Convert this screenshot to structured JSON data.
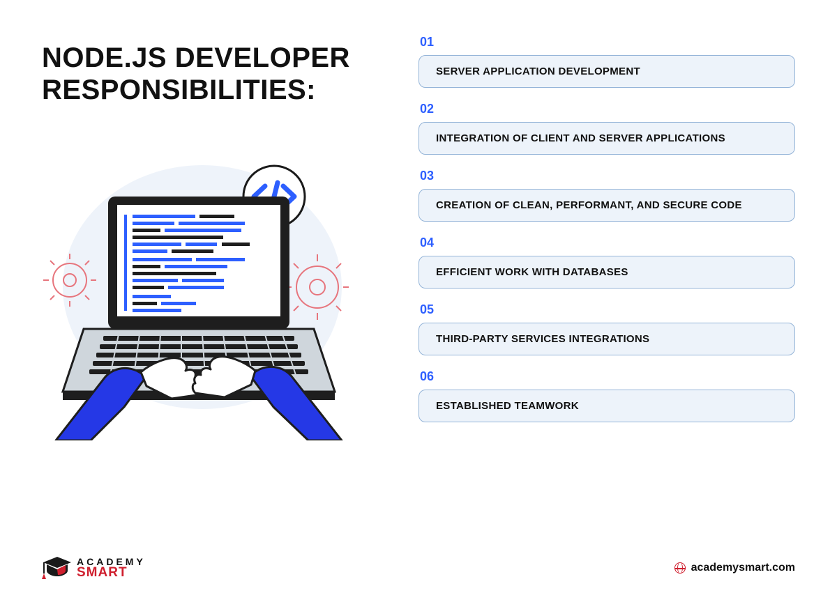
{
  "title": "NODE.JS DEVELOPER\nRESPONSIBILITIES:",
  "items": [
    {
      "num": "01",
      "text": "SERVER APPLICATION DEVELOPMENT"
    },
    {
      "num": "02",
      "text": "INTEGRATION OF CLIENT AND SERVER APPLICATIONS"
    },
    {
      "num": "03",
      "text": "CREATION OF CLEAN, PERFORMANT, AND SECURE CODE"
    },
    {
      "num": "04",
      "text": "EFFICIENT WORK WITH DATABASES"
    },
    {
      "num": "05",
      "text": "THIRD-PARTY SERVICES INTEGRATIONS"
    },
    {
      "num": "06",
      "text": "ESTABLISHED TEAMWORK"
    }
  ],
  "logo": {
    "top": "ACADEMY",
    "bottom": "SMART"
  },
  "url": "academysmart.com"
}
